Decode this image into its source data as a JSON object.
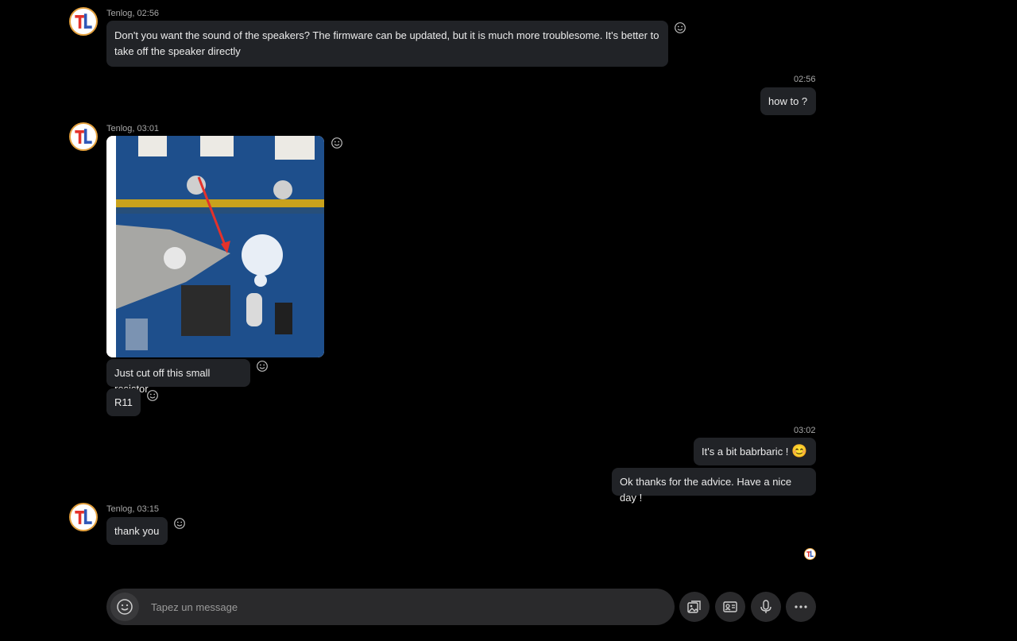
{
  "contact": {
    "name": "Tenlog"
  },
  "messages": {
    "m1": {
      "meta": "Tenlog, 02:56",
      "text": "Don't you want the sound of the speakers? The firmware can be updated, but it is much more troublesome. It's better to take off the speaker directly"
    },
    "m2": {
      "meta": "02:56",
      "text": "how to ?"
    },
    "m3": {
      "meta": "Tenlog, 03:01",
      "text1": "Just cut off this small resistor",
      "text2": "R11"
    },
    "m4": {
      "meta": "03:02",
      "text1": "It's a bit babrbaric !",
      "emoji": "😊",
      "text2": "Ok thanks for the advice. Have a nice day !"
    },
    "m5": {
      "meta": "Tenlog, 03:15",
      "text": "thank you"
    }
  },
  "composer": {
    "placeholder": "Tapez un message"
  },
  "icons": {
    "avatar": "tenlog-logo-icon",
    "react": "smiley-reaction-icon",
    "emoji": "emoji-icon",
    "gallery": "gallery-icon",
    "contact_card": "contact-card-icon",
    "microphone": "microphone-icon",
    "more": "more-dots-icon"
  },
  "colors": {
    "background": "#000000",
    "bubble": "#212327",
    "composer": "#2a2a2c",
    "logo_red": "#e4322b",
    "logo_blue": "#2f58b8",
    "avatar_ring": "#e3a03d"
  }
}
